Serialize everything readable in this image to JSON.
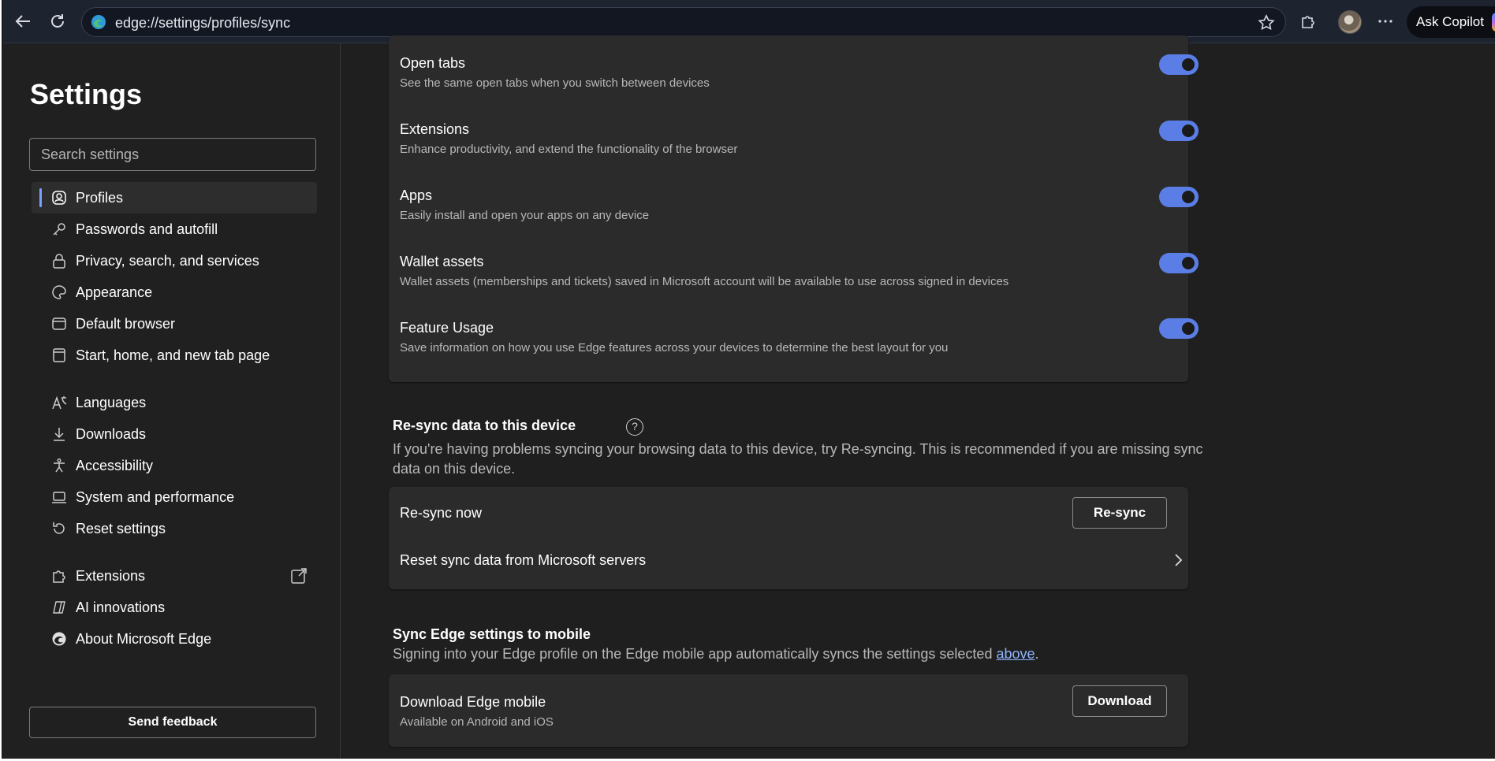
{
  "browser": {
    "url": "edge://settings/profiles/sync",
    "copilot_label": "Ask Copilot"
  },
  "sidebar": {
    "title": "Settings",
    "search_placeholder": "Search settings",
    "items": [
      {
        "label": "Profiles",
        "icon": "profile-icon",
        "active": true
      },
      {
        "label": "Passwords and autofill",
        "icon": "key-icon"
      },
      {
        "label": "Privacy, search, and services",
        "icon": "lock-icon"
      },
      {
        "label": "Appearance",
        "icon": "palette-icon"
      },
      {
        "label": "Default browser",
        "icon": "browser-icon"
      },
      {
        "label": "Start, home, and new tab page",
        "icon": "home-page-icon"
      },
      {
        "label": "Languages",
        "icon": "languages-icon"
      },
      {
        "label": "Downloads",
        "icon": "download-icon"
      },
      {
        "label": "Accessibility",
        "icon": "accessibility-icon"
      },
      {
        "label": "System and performance",
        "icon": "laptop-icon"
      },
      {
        "label": "Reset settings",
        "icon": "reset-icon"
      },
      {
        "label": "Extensions",
        "icon": "puzzle-icon"
      },
      {
        "label": "AI innovations",
        "icon": "ai-icon"
      },
      {
        "label": "About Microsoft Edge",
        "icon": "edge-logo-icon"
      }
    ],
    "feedback_label": "Send feedback"
  },
  "sync_items": [
    {
      "title": "Open tabs",
      "desc": "See the same open tabs when you switch between devices",
      "on": true
    },
    {
      "title": "Extensions",
      "desc": "Enhance productivity, and extend the functionality of the browser",
      "on": true
    },
    {
      "title": "Apps",
      "desc": "Easily install and open your apps on any device",
      "on": true
    },
    {
      "title": "Wallet assets",
      "desc": "Wallet assets (memberships and tickets) saved in Microsoft account will be available to use across signed in devices",
      "on": true
    },
    {
      "title": "Feature Usage",
      "desc": "Save information on how you use Edge features across your devices to determine the best layout for you",
      "on": true
    }
  ],
  "resync": {
    "title": "Re-sync data to this device",
    "desc_line1": "If you're having problems syncing your browsing data to this device, try Re-syncing. This is recommended if you are missing sync",
    "desc_line2": "data on this device.",
    "resync_now_label": "Re-sync now",
    "resync_button": "Re-sync",
    "reset_label": "Reset sync data from Microsoft servers"
  },
  "mobile": {
    "title": "Sync Edge settings to mobile",
    "desc_before": "Signing into your Edge profile on the Edge mobile app automatically syncs the settings selected ",
    "desc_link": "above",
    "desc_after": ".",
    "download_title": "Download Edge mobile",
    "download_desc": "Available on Android and iOS",
    "download_button": "Download"
  },
  "colors": {
    "accent": "#5a7ee6",
    "background": "#1f1f1f",
    "card": "#2b2b2b"
  }
}
